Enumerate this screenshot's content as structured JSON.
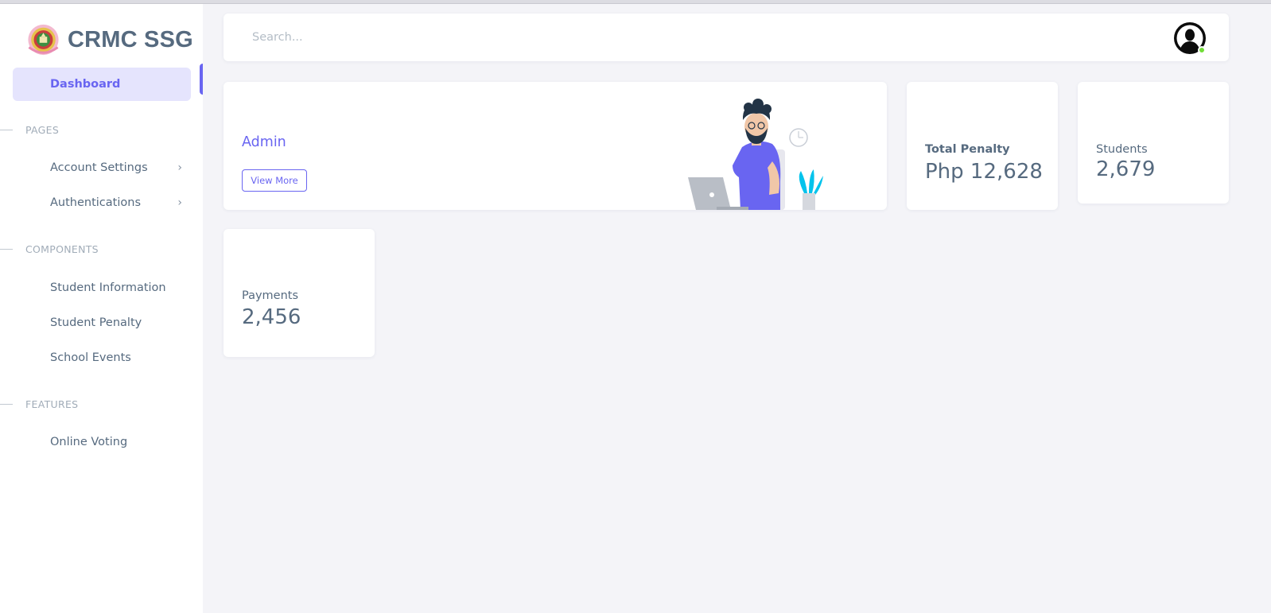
{
  "brand": {
    "name": "CRMC SSG"
  },
  "sidebar": {
    "active_item": "Dashboard",
    "sections": [
      {
        "title": "PAGES",
        "items": [
          {
            "label": "Account Settings",
            "has_submenu": true
          },
          {
            "label": "Authentications",
            "has_submenu": true
          }
        ]
      },
      {
        "title": "COMPONENTS",
        "items": [
          {
            "label": "Student Information",
            "has_submenu": false
          },
          {
            "label": "Student Penalty",
            "has_submenu": false
          },
          {
            "label": "School Events",
            "has_submenu": false
          }
        ]
      },
      {
        "title": "FEATURES",
        "items": [
          {
            "label": "Online Voting",
            "has_submenu": false
          }
        ]
      }
    ],
    "chevron": "›"
  },
  "navbar": {
    "search_placeholder": "Search...",
    "avatar_status": "online"
  },
  "welcome": {
    "title": "Admin",
    "button_label": "View More"
  },
  "stats": {
    "penalty": {
      "label": "Total Penalty",
      "value": "Php 12,628"
    },
    "students": {
      "label": "Students",
      "value": "2,679"
    },
    "payments": {
      "label": "Payments",
      "value": "2,456"
    }
  },
  "colors": {
    "accent": "#6965f1",
    "accent_light": "#e5e4fd",
    "text": "#566a7f",
    "muted": "#a1acb8",
    "background": "#f4f4f8",
    "online": "#71dd37"
  }
}
